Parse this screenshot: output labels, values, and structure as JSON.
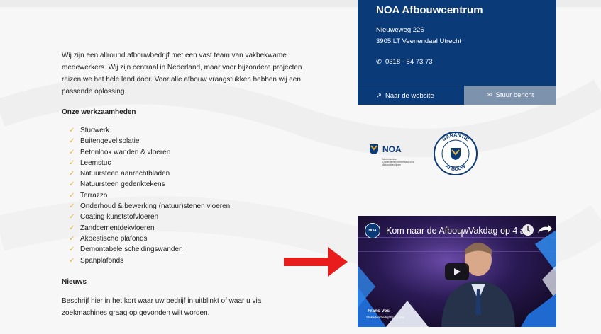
{
  "intro": "Wij zijn een allround afbouwbedrijf met een vast team van vakbekwame medewerkers. Wij zijn centraal in Nederland, maar voor bijzondere projecten reizen we het hele land door. Voor alle afbouw vraagstukken hebben wij een passende oplossing.",
  "work_heading": "Onze werkzaamheden",
  "work_items": [
    "Stucwerk",
    "Buitengevelisolatie",
    "Betonlook wanden & vloeren",
    "Leemstuc",
    "Natuursteen aanrechtbladen",
    "Natuursteen gedenktekens",
    "Terrazzo",
    "Onderhoud & bewerking (natuur)stenen vloeren",
    "Coating kunststofvloeren",
    "Zandcementdekvloeren",
    "Akoestische plafonds",
    "Demontabele scheidingswanden",
    "Spanplafonds"
  ],
  "news_heading": "Nieuws",
  "news_text": "Beschrijf hier in het kort waar uw bedrijf in uitblinkt of waar u via zoekmachines graag op gevonden wilt worden.",
  "card": {
    "title": "NOA Afbouwcentrum",
    "street": "Nieuweweg 226",
    "city": "3905 LT   Veenendaal   Utrecht",
    "phone": "0318 - 54 73 73",
    "website_label": "Naar de website",
    "message_label": "Stuur bericht"
  },
  "logos": {
    "noa_text": "NOA",
    "noa_sub": "Nederlandse Ondernemersvereniging voor Afbouwbedrijven",
    "seal_top": "GARANTIE",
    "seal_bottom": "AFBOUW",
    "seal_center": "NOA"
  },
  "video": {
    "badge": "NOA",
    "title": "Kom naar de AfbouwVakdag op 4 a...",
    "person_name": "Frans Vos",
    "person_company": "Stukadoorbedrijf Frans Vos"
  },
  "colors": {
    "navy": "#0a3a78",
    "button_grey": "#7d92ad",
    "check_yellow": "#e4b43a",
    "arrow_red": "#e81c1c"
  }
}
